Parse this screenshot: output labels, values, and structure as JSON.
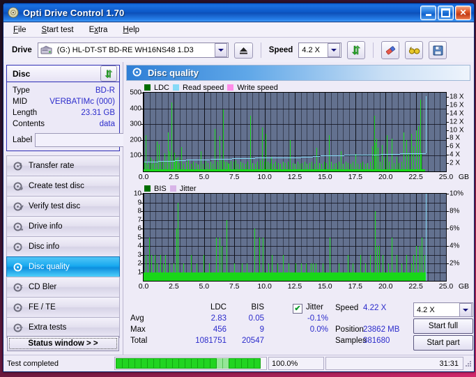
{
  "window": {
    "title": "Opti Drive Control 1.70",
    "icon": "disc-icon",
    "buttons": {
      "minimize": "_",
      "maximize": "□",
      "close": "✕"
    }
  },
  "menubar": {
    "items": [
      "File",
      "Start test",
      "Extra",
      "Help"
    ]
  },
  "toolbar": {
    "drive_label": "Drive",
    "drive_value": "(G:)  HL-DT-ST BD-RE  WH16NS48 1.D3",
    "speed_label": "Speed",
    "speed_value": "4.2 X",
    "icons": [
      "refresh-icon",
      "eject-icon",
      "eraser-icon",
      "glasses-icon",
      "save-icon"
    ]
  },
  "disc": {
    "title": "Disc",
    "refresh_icon": "refresh-icon",
    "rows": [
      {
        "key": "Type",
        "value": "BD-R"
      },
      {
        "key": "MID",
        "value": "VERBATIMc (000)"
      },
      {
        "key": "Length",
        "value": "23.31 GB"
      },
      {
        "key": "Contents",
        "value": "data"
      }
    ],
    "label_key": "Label",
    "label_value": "",
    "label_placeholder": ""
  },
  "nav": {
    "items": [
      {
        "label": "Transfer rate",
        "active": false
      },
      {
        "label": "Create test disc",
        "active": false
      },
      {
        "label": "Verify test disc",
        "active": false
      },
      {
        "label": "Drive info",
        "active": false
      },
      {
        "label": "Disc info",
        "active": false
      },
      {
        "label": "Disc quality",
        "active": true
      },
      {
        "label": "CD Bler",
        "active": false
      },
      {
        "label": "FE / TE",
        "active": false
      },
      {
        "label": "Extra tests",
        "active": false
      }
    ],
    "status_window": "Status window > >"
  },
  "panel": {
    "title": "Disc quality",
    "icon": "disc-quality-icon"
  },
  "stats": {
    "col_ldc": "LDC",
    "col_bis": "BIS",
    "jitter_label": "Jitter",
    "jitter_checked": true,
    "row_avg": "Avg",
    "row_max": "Max",
    "row_total": "Total",
    "ldc_avg": "2.83",
    "ldc_max": "456",
    "ldc_total": "1081751",
    "bis_avg": "0.05",
    "bis_max": "9",
    "bis_total": "20547",
    "jitter_avg": "-0.1%",
    "jitter_max": "0.0%",
    "speed_label": "Speed",
    "speed_value": "4.22 X",
    "position_label": "Position",
    "position_value": "23862 MB",
    "samples_label": "Samples",
    "samples_value": "381680",
    "speed_select": "4.2 X",
    "start_full": "Start full",
    "start_part": "Start part"
  },
  "statusbar": {
    "message": "Test completed",
    "percent": "100.0%",
    "elapsed": "31:31",
    "progress_value": 100
  },
  "colors": {
    "ldc_green": "#19d719",
    "read_speed": "#86daf7",
    "write_speed": "#ff8ce8",
    "bis_green": "#19d719",
    "jitter_pink": "#d8b4e8",
    "plot_bg": "#63718f",
    "accent_blue": "#2b2bcb"
  },
  "chart_data": [
    {
      "type": "bar",
      "id": "ldc-chart",
      "title": "",
      "legend": [
        {
          "label": "LDC",
          "color": "#006e00"
        },
        {
          "label": "Read speed",
          "color": "#86daf7"
        },
        {
          "label": "Write speed",
          "color": "#ff8ce8"
        }
      ],
      "legend_position": "top-left",
      "grid": true,
      "xlabel": "GB",
      "ylabel": "",
      "xlim": [
        0,
        25
      ],
      "ylim": [
        0,
        500
      ],
      "yticks": [
        100,
        200,
        300,
        400,
        500
      ],
      "xticks": [
        0.0,
        2.5,
        5.0,
        7.5,
        10.0,
        12.5,
        15.0,
        17.5,
        20.0,
        22.5,
        25.0
      ],
      "xticklabels": [
        "0.0",
        "2.5",
        "5.0",
        "7.5",
        "10.0",
        "12.5",
        "15.0",
        "17.5",
        "20.0",
        "22.5",
        "25.0"
      ],
      "y2label": "X",
      "y2lim": [
        0,
        19
      ],
      "y2ticks": [
        2,
        4,
        6,
        8,
        10,
        12,
        14,
        16,
        18
      ],
      "y2ticklabels": [
        "2 X",
        "4 X",
        "6 X",
        "8 X",
        "10 X",
        "12 X",
        "14 X",
        "16 X",
        "18 X"
      ],
      "series": [
        {
          "name": "LDC",
          "color": "#19d719",
          "x": [
            0.05,
            0.15,
            0.3,
            0.42,
            0.55,
            0.68,
            0.8,
            0.95,
            1.1,
            1.25,
            1.4,
            1.55,
            1.7,
            1.85,
            2.0,
            2.15,
            2.3,
            2.45,
            2.55,
            2.62,
            2.7,
            2.8,
            2.95,
            3.1,
            3.3,
            3.5,
            3.7,
            3.9,
            4.1,
            4.3,
            4.5,
            4.7,
            4.9,
            5.1,
            5.3,
            5.5,
            5.7,
            5.9,
            6.1,
            6.25,
            6.4,
            6.55,
            6.7,
            6.85,
            6.95,
            7.05,
            7.2,
            7.4,
            7.6,
            7.8,
            8.0,
            8.2,
            8.4,
            8.6,
            8.8,
            9.0,
            9.2,
            9.4,
            9.6,
            9.8,
            9.95,
            10.1,
            10.25,
            10.4,
            10.55,
            10.7,
            10.9,
            11.1,
            11.3,
            11.5,
            11.7,
            11.9,
            12.1,
            12.3,
            12.5,
            12.7,
            12.9,
            13.1,
            13.3,
            13.5,
            13.7,
            13.9,
            14.1,
            14.3,
            14.5,
            14.7,
            14.9,
            15.1,
            15.3,
            15.5,
            15.7,
            15.9,
            16.1,
            16.3,
            16.5,
            16.7,
            16.9,
            17.1,
            17.3,
            17.5,
            17.7,
            17.9,
            18.1,
            18.3,
            18.5,
            18.7,
            18.9,
            19.05,
            19.15,
            19.25,
            19.35,
            19.5,
            19.7,
            19.9,
            20.1,
            20.3,
            20.5,
            20.7,
            20.9,
            21.1,
            21.3,
            21.5,
            21.7,
            21.9,
            22.1,
            22.3,
            22.5,
            22.7,
            22.85,
            22.95,
            23.05,
            23.15,
            23.25,
            23.3
          ],
          "values": [
            60,
            230,
            45,
            60,
            90,
            50,
            75,
            55,
            190,
            175,
            60,
            60,
            115,
            70,
            250,
            130,
            440,
            70,
            120,
            65,
            85,
            95,
            55,
            155,
            50,
            60,
            70,
            50,
            60,
            55,
            45,
            130,
            50,
            65,
            55,
            60,
            50,
            270,
            60,
            225,
            70,
            395,
            60,
            60,
            55,
            50,
            65,
            60,
            70,
            50,
            60,
            55,
            50,
            60,
            355,
            55,
            50,
            60,
            70,
            280,
            60,
            240,
            60,
            55,
            95,
            50,
            60,
            55,
            50,
            60,
            55,
            60,
            200,
            55,
            50,
            60,
            50,
            55,
            60,
            50,
            55,
            60,
            50,
            150,
            55,
            50,
            60,
            55,
            230,
            60,
            50,
            55,
            60,
            130,
            50,
            60,
            55,
            50,
            60,
            110,
            50,
            55,
            60,
            50,
            55,
            60,
            160,
            355,
            180,
            210,
            150,
            60,
            170,
            90,
            230,
            60,
            210,
            55,
            95,
            55,
            60,
            250,
            200,
            120,
            240,
            160,
            260,
            290,
            456,
            120
          ]
        },
        {
          "name": "Read speed",
          "color": "#86daf7",
          "x": [
            0.05,
            1.2,
            1.8,
            2.6,
            3.5,
            4.5,
            5.5,
            6.4,
            7.3,
            8.2,
            9.2,
            10.1,
            11.0,
            12.0,
            13.0,
            14.0,
            14.6,
            15.6,
            16.6,
            17.6,
            18.6,
            19.6,
            20.6,
            21.2,
            22.2,
            23.1,
            23.3
          ],
          "values_x_speed": [
            2.3,
            2.5,
            2.6,
            2.7,
            2.8,
            2.9,
            3.0,
            3.1,
            3.2,
            3.25,
            3.3,
            3.35,
            3.4,
            3.45,
            3.5,
            3.7,
            3.8,
            3.95,
            4.0,
            4.05,
            4.1,
            4.15,
            4.25,
            4.35,
            4.4,
            4.45,
            18.2
          ]
        }
      ]
    },
    {
      "type": "bar",
      "id": "bis-chart",
      "title": "",
      "legend": [
        {
          "label": "BIS",
          "color": "#006e00"
        },
        {
          "label": "Jitter",
          "color": "#d8b4e8"
        }
      ],
      "legend_position": "top-left",
      "grid": true,
      "xlabel": "GB",
      "ylabel": "",
      "xlim": [
        0,
        25
      ],
      "ylim": [
        0,
        10
      ],
      "yticks": [
        1,
        2,
        3,
        4,
        5,
        6,
        7,
        8,
        9,
        10
      ],
      "xticks": [
        0.0,
        2.5,
        5.0,
        7.5,
        10.0,
        12.5,
        15.0,
        17.5,
        20.0,
        22.5,
        25.0
      ],
      "xticklabels": [
        "0.0",
        "2.5",
        "5.0",
        "7.5",
        "10.0",
        "12.5",
        "15.0",
        "17.5",
        "20.0",
        "22.5",
        "25.0"
      ],
      "y2label": "%",
      "y2lim": [
        0,
        10
      ],
      "y2ticks": [
        2,
        4,
        6,
        8,
        10
      ],
      "y2ticklabels": [
        "2%",
        "4%",
        "6%",
        "8%",
        "10%"
      ],
      "series": [
        {
          "name": "BIS",
          "color": "#19d719",
          "x": [
            0.05,
            0.15,
            0.25,
            0.35,
            0.45,
            0.55,
            0.62,
            0.7,
            0.8,
            0.9,
            1.0,
            1.1,
            1.2,
            1.3,
            1.4,
            1.5,
            1.6,
            1.7,
            1.8,
            1.9,
            2.0,
            2.1,
            2.2,
            2.3,
            2.4,
            2.5,
            2.6,
            2.7,
            2.8,
            2.9,
            3.0,
            3.15,
            3.3,
            3.45,
            3.6,
            3.75,
            3.9,
            4.05,
            4.2,
            4.35,
            4.5,
            4.65,
            4.8,
            4.95,
            5.1,
            5.25,
            5.4,
            5.55,
            5.7,
            5.85,
            6.0,
            6.15,
            6.25,
            6.35,
            6.45,
            6.55,
            6.7,
            6.85,
            6.95,
            7.05,
            7.2,
            7.35,
            7.5,
            7.65,
            7.8,
            7.95,
            8.1,
            8.25,
            8.4,
            8.55,
            8.7,
            8.85,
            9.0,
            9.15,
            9.3,
            9.45,
            9.55,
            9.7,
            9.85,
            10.0,
            10.15,
            10.3,
            10.45,
            10.6,
            10.75,
            10.9,
            11.05,
            11.2,
            11.35,
            11.5,
            11.65,
            11.8,
            11.95,
            12.1,
            12.25,
            12.4,
            12.55,
            12.7,
            12.85,
            13.0,
            13.2,
            13.4,
            13.6,
            13.8,
            14.0,
            14.2,
            14.4,
            14.6,
            14.8,
            15.0,
            15.2,
            15.4,
            15.6,
            15.8,
            15.9,
            16.1,
            16.3,
            16.5,
            16.7,
            16.9,
            17.1,
            17.3,
            17.5,
            17.7,
            17.9,
            18.1,
            18.3,
            18.5,
            18.7,
            18.9,
            19.1,
            19.2,
            19.3,
            19.45,
            19.6,
            19.75,
            19.9,
            20.05,
            20.2,
            20.35,
            20.5,
            20.7,
            20.9,
            21.1,
            21.3,
            21.5,
            21.7,
            21.9,
            22.1,
            22.3,
            22.5,
            22.65,
            22.8,
            22.9,
            23.0,
            23.1,
            23.2,
            23.28
          ],
          "values": [
            1,
            3,
            1,
            1,
            5,
            1,
            3,
            1,
            1,
            3,
            1,
            2,
            1,
            1,
            3,
            1,
            2,
            1,
            3,
            1,
            1,
            2,
            1,
            1,
            1,
            2,
            1,
            6,
            9,
            1,
            1,
            1,
            2,
            1,
            1,
            1,
            3,
            1,
            1,
            2,
            1,
            1,
            1,
            3,
            1,
            1,
            2,
            1,
            1,
            1,
            5,
            1,
            5,
            1,
            4,
            1,
            1,
            7,
            1,
            1,
            1,
            1,
            2,
            1,
            1,
            1,
            2,
            1,
            1,
            2,
            1,
            1,
            1,
            6,
            1,
            1,
            5,
            1,
            5,
            1,
            1,
            2,
            1,
            3,
            1,
            1,
            2,
            1,
            1,
            3,
            1,
            1,
            2,
            1,
            1,
            1,
            2,
            1,
            1,
            2,
            1,
            2,
            1,
            2,
            2,
            2,
            1,
            1,
            2,
            1,
            1,
            5,
            1,
            1,
            1,
            2,
            1,
            1,
            1,
            3,
            1,
            2,
            1,
            1,
            3,
            1,
            2,
            1,
            3,
            1,
            8,
            1,
            4,
            4,
            1,
            3,
            1,
            1,
            2,
            1,
            5,
            1,
            3,
            1,
            2,
            1,
            3,
            1,
            2,
            3,
            4,
            1,
            4,
            1,
            5,
            1,
            3,
            1
          ]
        }
      ]
    }
  ]
}
